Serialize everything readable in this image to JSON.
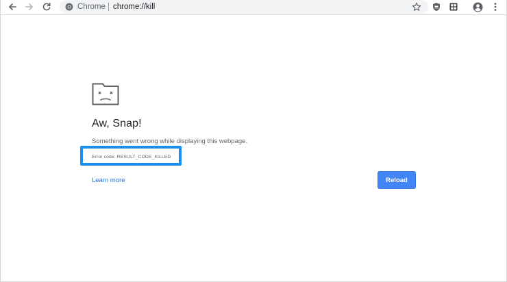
{
  "toolbar": {
    "back_icon": "arrow-left-icon",
    "forward_icon": "arrow-right-icon",
    "reload_icon": "refresh-icon",
    "omnibox": {
      "site_label": "Chrome",
      "url": "chrome://kill"
    },
    "bookmark_icon": "star-icon",
    "extensions": [
      "shield-extension-icon",
      "grid-extension-icon"
    ],
    "profile_icon": "account-circle-icon",
    "menu_icon": "vertical-dots-icon"
  },
  "page": {
    "icon": "sad-tab-icon",
    "heading": "Aw, Snap!",
    "message": "Something went wrong while displaying this webpage.",
    "error_code": "Error code: RESULT_CODE_KILLED",
    "learn_more": "Learn more",
    "reload_label": "Reload"
  },
  "colors": {
    "accent": "#1a73e8",
    "button": "#4285f4",
    "highlight": "#1a8fef"
  }
}
